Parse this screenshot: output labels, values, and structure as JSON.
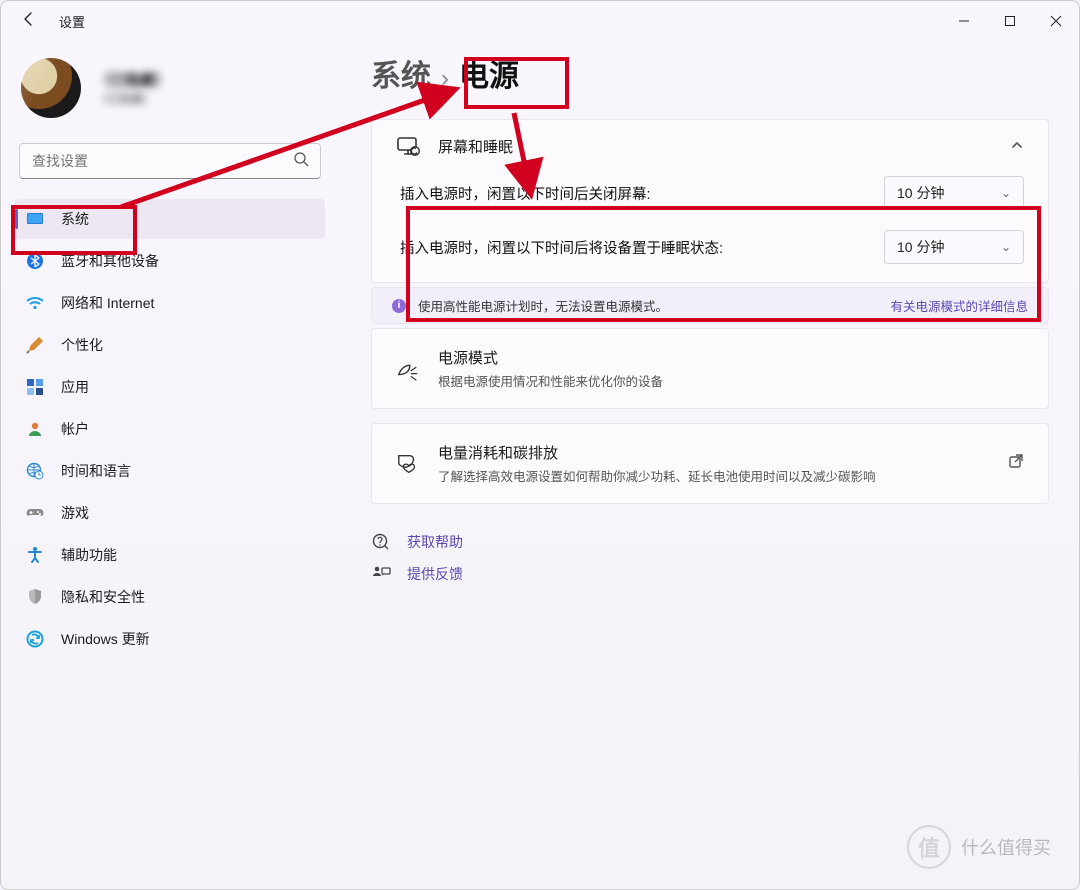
{
  "window": {
    "title": "设置"
  },
  "user": {
    "name": "（已隐藏）",
    "email": "（已隐藏）"
  },
  "search": {
    "placeholder": "查找设置"
  },
  "sidebar": {
    "items": [
      {
        "label": "系统"
      },
      {
        "label": "蓝牙和其他设备"
      },
      {
        "label": "网络和 Internet"
      },
      {
        "label": "个性化"
      },
      {
        "label": "应用"
      },
      {
        "label": "帐户"
      },
      {
        "label": "时间和语言"
      },
      {
        "label": "游戏"
      },
      {
        "label": "辅助功能"
      },
      {
        "label": "隐私和安全性"
      },
      {
        "label": "Windows 更新"
      }
    ]
  },
  "breadcrumb": {
    "parent": "系统",
    "current": "电源"
  },
  "screen_sleep": {
    "heading": "屏幕和睡眠",
    "row1_label": "插入电源时，闲置以下时间后关闭屏幕:",
    "row1_value": "10 分钟",
    "row2_label": "插入电源时，闲置以下时间后将设备置于睡眠状态:",
    "row2_value": "10 分钟"
  },
  "infobar": {
    "text": "使用高性能电源计划时，无法设置电源模式。",
    "link": "有关电源模式的详细信息"
  },
  "power_mode": {
    "title": "电源模式",
    "sub": "根据电源使用情况和性能来优化你的设备"
  },
  "carbon": {
    "title": "电量消耗和碳排放",
    "sub": "了解选择高效电源设置如何帮助你减少功耗、延长电池使用时间以及减少碳影响"
  },
  "footer": {
    "help": "获取帮助",
    "feedback": "提供反馈"
  },
  "watermark": {
    "text": "什么值得买",
    "symbol": "值"
  }
}
